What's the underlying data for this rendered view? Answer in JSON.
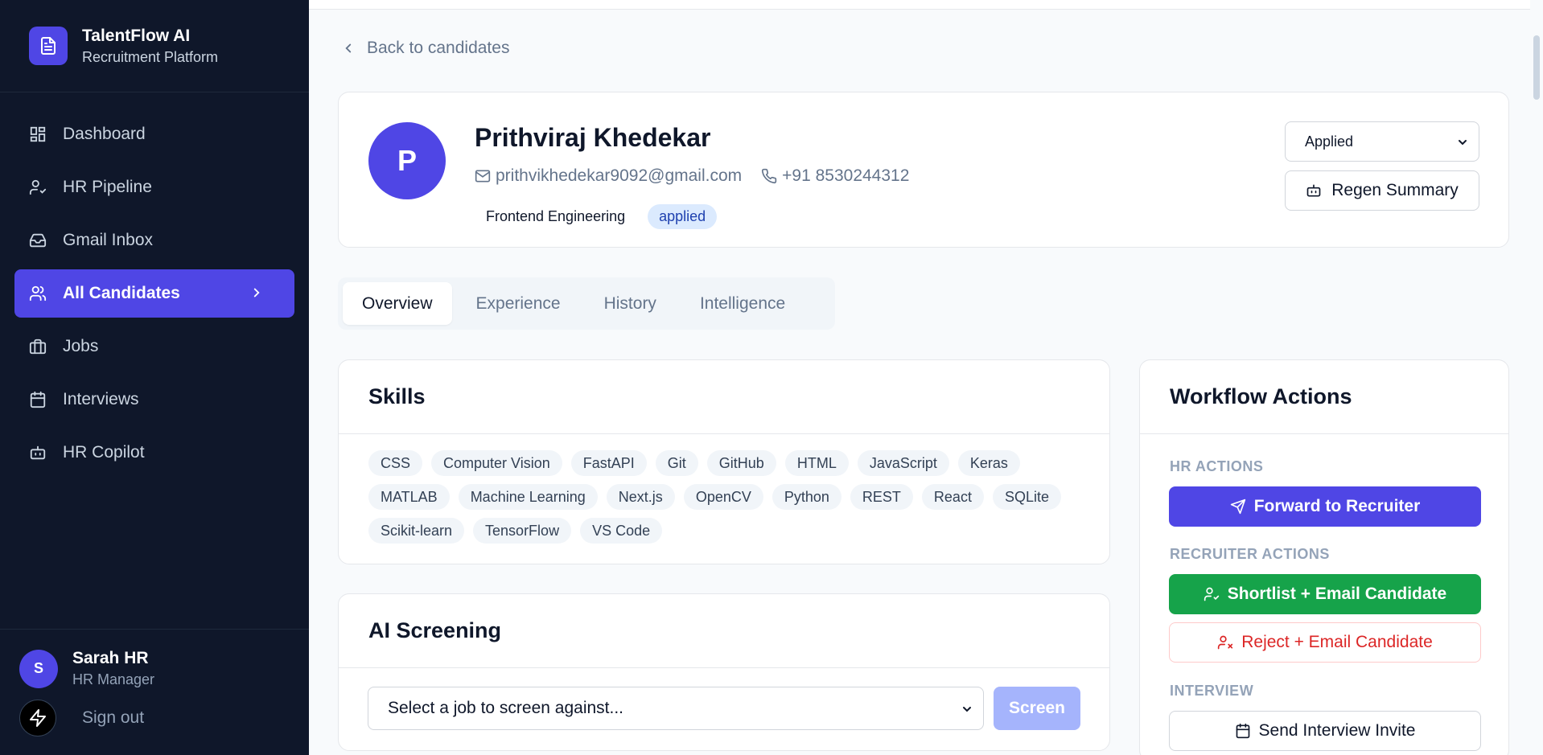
{
  "sidebar": {
    "brand_title": "TalentFlow AI",
    "brand_subtitle": "Recruitment Platform",
    "nav": [
      {
        "label": "Dashboard",
        "icon": "dashboard-icon"
      },
      {
        "label": "HR Pipeline",
        "icon": "user-check-icon"
      },
      {
        "label": "Gmail Inbox",
        "icon": "inbox-icon"
      },
      {
        "label": "All Candidates",
        "icon": "users-icon",
        "active": true
      },
      {
        "label": "Jobs",
        "icon": "briefcase-icon"
      },
      {
        "label": "Interviews",
        "icon": "calendar-icon"
      },
      {
        "label": "HR Copilot",
        "icon": "bot-icon"
      }
    ],
    "user": {
      "initial": "S",
      "name": "Sarah HR",
      "role": "HR Manager"
    },
    "signout_label": "Sign out"
  },
  "back_label": "Back to candidates",
  "candidate": {
    "initial": "P",
    "name": "Prithviraj Khedekar",
    "email": "prithvikhedekar9092@gmail.com",
    "phone": "+91 8530244312",
    "department": "Frontend Engineering",
    "status_badge": "applied",
    "status_select": "Applied",
    "regen_label": "Regen Summary"
  },
  "tabs": [
    "Overview",
    "Experience",
    "History",
    "Intelligence"
  ],
  "skills": {
    "title": "Skills",
    "items": [
      "CSS",
      "Computer Vision",
      "FastAPI",
      "Git",
      "GitHub",
      "HTML",
      "JavaScript",
      "Keras",
      "MATLAB",
      "Machine Learning",
      "Next.js",
      "OpenCV",
      "Python",
      "REST",
      "React",
      "SQLite",
      "Scikit-learn",
      "TensorFlow",
      "VS Code"
    ]
  },
  "screening": {
    "title": "AI Screening",
    "select_placeholder": "Select a job to screen against...",
    "screen_label": "Screen"
  },
  "workflow": {
    "title": "Workflow Actions",
    "hr_label": "HR ACTIONS",
    "forward_label": "Forward to Recruiter",
    "recruiter_label": "RECRUITER ACTIONS",
    "shortlist_label": "Shortlist + Email Candidate",
    "reject_label": "Reject + Email Candidate",
    "interview_label": "INTERVIEW",
    "invite_label": "Send Interview Invite"
  },
  "colors": {
    "accent": "#4f46e5",
    "sidebar_bg": "#0f172a",
    "success": "#16a34a",
    "danger": "#dc2626"
  }
}
